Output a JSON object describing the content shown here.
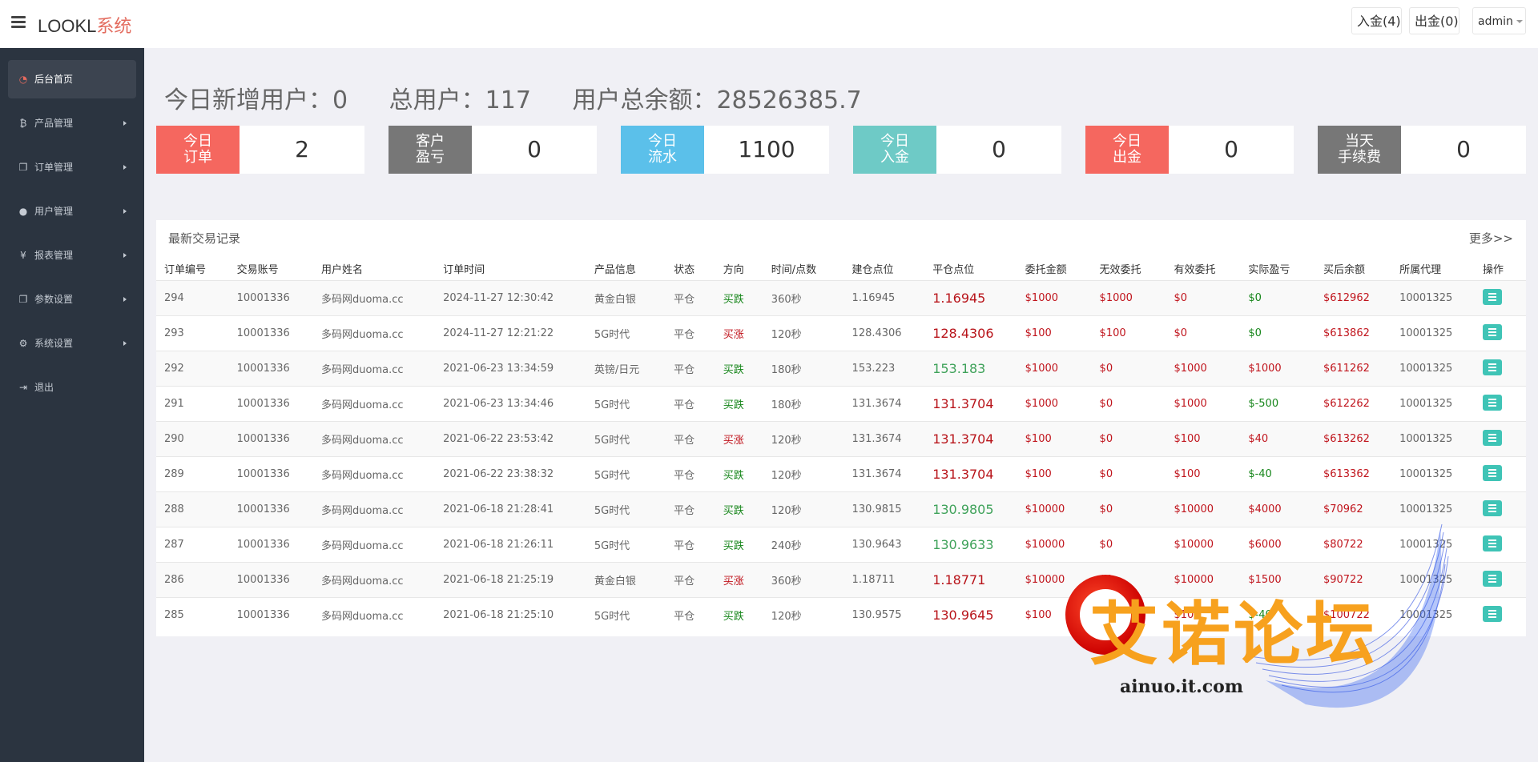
{
  "header": {
    "brand_main": "LOOKL",
    "brand_suffix": "系统",
    "deposit": "入金(4)",
    "withdraw": "出金(0)",
    "user": "admin"
  },
  "sidebar": {
    "items": [
      {
        "label": "后台首页",
        "icon": "dashboard-icon",
        "active": true
      },
      {
        "label": "产品管理",
        "icon": "bitcoin-icon"
      },
      {
        "label": "订单管理",
        "icon": "copy-icon"
      },
      {
        "label": "用户管理",
        "icon": "user-icon"
      },
      {
        "label": "报表管理",
        "icon": "yen-icon"
      },
      {
        "label": "参数设置",
        "icon": "copy-icon"
      },
      {
        "label": "系统设置",
        "icon": "gears-icon"
      },
      {
        "label": "退出",
        "icon": "sign-out-icon"
      }
    ]
  },
  "summary": {
    "new_users": "今日新增用户：0",
    "total_users": "总用户：117",
    "total_balance": "用户总余额：28526385.7"
  },
  "stats": [
    {
      "l1": "今日",
      "l2": "订单",
      "value": "2",
      "color": "#f5675f"
    },
    {
      "l1": "客户",
      "l2": "盈亏",
      "value": "0",
      "color": "#777777"
    },
    {
      "l1": "今日",
      "l2": "流水",
      "value": "1100",
      "color": "#5bc0ea"
    },
    {
      "l1": "今日",
      "l2": "入金",
      "value": "0",
      "color": "#6ecac6"
    },
    {
      "l1": "今日",
      "l2": "出金",
      "value": "0",
      "color": "#f5675f"
    },
    {
      "l1": "当天",
      "l2": "手续费",
      "value": "0",
      "color": "#777777"
    }
  ],
  "panel": {
    "title": "最新交易记录",
    "more": "更多>>",
    "columns": [
      "订单编号",
      "交易账号",
      "用户姓名",
      "订单时间",
      "产品信息",
      "状态",
      "方向",
      "时间/点数",
      "建仓点位",
      "平仓点位",
      "委托金额",
      "无效委托",
      "有效委托",
      "实际盈亏",
      "买后余额",
      "所属代理",
      "操作"
    ],
    "rows": [
      [
        "294",
        "10001336",
        "多码网duoma.cc",
        "2024-11-27 12:30:42",
        "黄金白银",
        "平仓",
        "买跌",
        "360秒",
        "1.16945",
        "1.16945",
        "$1000",
        "$1000",
        "$0",
        "$0",
        "$612962",
        "10001325"
      ],
      [
        "293",
        "10001336",
        "多码网duoma.cc",
        "2024-11-27 12:21:22",
        "5G时代",
        "平仓",
        "买涨",
        "120秒",
        "128.4306",
        "128.4306",
        "$100",
        "$100",
        "$0",
        "$0",
        "$613862",
        "10001325"
      ],
      [
        "292",
        "10001336",
        "多码网duoma.cc",
        "2021-06-23 13:34:59",
        "英镑/日元",
        "平仓",
        "买跌",
        "180秒",
        "153.223",
        "153.183",
        "$1000",
        "$0",
        "$1000",
        "$1000",
        "$611262",
        "10001325"
      ],
      [
        "291",
        "10001336",
        "多码网duoma.cc",
        "2021-06-23 13:34:46",
        "5G时代",
        "平仓",
        "买跌",
        "180秒",
        "131.3674",
        "131.3704",
        "$1000",
        "$0",
        "$1000",
        "$-500",
        "$612262",
        "10001325"
      ],
      [
        "290",
        "10001336",
        "多码网duoma.cc",
        "2021-06-22 23:53:42",
        "5G时代",
        "平仓",
        "买涨",
        "120秒",
        "131.3674",
        "131.3704",
        "$100",
        "$0",
        "$100",
        "$40",
        "$613262",
        "10001325"
      ],
      [
        "289",
        "10001336",
        "多码网duoma.cc",
        "2021-06-22 23:38:32",
        "5G时代",
        "平仓",
        "买跌",
        "120秒",
        "131.3674",
        "131.3704",
        "$100",
        "$0",
        "$100",
        "$-40",
        "$613362",
        "10001325"
      ],
      [
        "288",
        "10001336",
        "多码网duoma.cc",
        "2021-06-18 21:28:41",
        "5G时代",
        "平仓",
        "买跌",
        "120秒",
        "130.9815",
        "130.9805",
        "$10000",
        "$0",
        "$10000",
        "$4000",
        "$70962",
        "10001325"
      ],
      [
        "287",
        "10001336",
        "多码网duoma.cc",
        "2021-06-18 21:26:11",
        "5G时代",
        "平仓",
        "买跌",
        "240秒",
        "130.9643",
        "130.9633",
        "$10000",
        "$0",
        "$10000",
        "$6000",
        "$80722",
        "10001325"
      ],
      [
        "286",
        "10001336",
        "多码网duoma.cc",
        "2021-06-18 21:25:19",
        "黄金白银",
        "平仓",
        "买涨",
        "360秒",
        "1.18711",
        "1.18771",
        "$10000",
        "$0",
        "$10000",
        "$1500",
        "$90722",
        "10001325"
      ],
      [
        "285",
        "10001336",
        "多码网duoma.cc",
        "2021-06-18 21:25:10",
        "5G时代",
        "平仓",
        "买跌",
        "120秒",
        "130.9575",
        "130.9645",
        "$100",
        "$0",
        "$100",
        "$-40",
        "$100722",
        "10001325"
      ]
    ],
    "close_colors": [
      "red",
      "red",
      "green",
      "red",
      "red",
      "red",
      "green",
      "green",
      "red",
      "red"
    ],
    "profit_colors": [
      "green",
      "green",
      "red",
      "green",
      "red",
      "green",
      "red",
      "red",
      "red",
      "green"
    ]
  },
  "watermark": {
    "text": "艾诺论坛",
    "url": "ainuo.it.com"
  }
}
